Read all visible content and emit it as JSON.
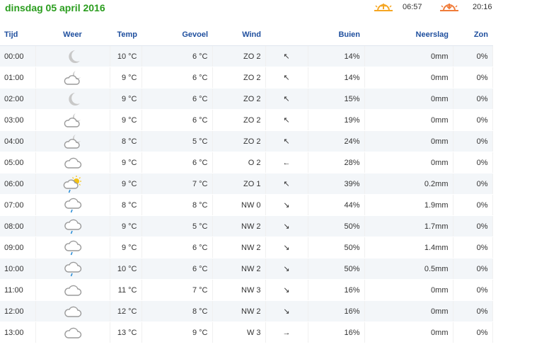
{
  "page": {
    "date_title": "dinsdag 05 april 2016",
    "sunrise": "06:57",
    "sunset": "20:16",
    "sunrise_icon": "sunrise-icon",
    "sunset_icon": "sunset-icon",
    "accent_color": "#2a9d1e",
    "header_color": "#1f4f9e"
  },
  "table": {
    "headers": {
      "time": "Tijd",
      "weather": "Weer",
      "temp": "Temp",
      "feels": "Gevoel",
      "wind": "Wind",
      "showers": "Buien",
      "precip": "Neerslag",
      "sun": "Zon"
    },
    "rows": [
      {
        "time": "00:00",
        "icon": "moon",
        "temp": "10 °C",
        "feels": "6 °C",
        "wind": "ZO 2",
        "arrow": "↖",
        "showers": "14%",
        "precip": "0mm",
        "sun": "0%"
      },
      {
        "time": "01:00",
        "icon": "cloud-moon",
        "temp": "9 °C",
        "feels": "6 °C",
        "wind": "ZO 2",
        "arrow": "↖",
        "showers": "14%",
        "precip": "0mm",
        "sun": "0%"
      },
      {
        "time": "02:00",
        "icon": "moon",
        "temp": "9 °C",
        "feels": "6 °C",
        "wind": "ZO 2",
        "arrow": "↖",
        "showers": "15%",
        "precip": "0mm",
        "sun": "0%"
      },
      {
        "time": "03:00",
        "icon": "cloud-moon",
        "temp": "9 °C",
        "feels": "6 °C",
        "wind": "ZO 2",
        "arrow": "↖",
        "showers": "19%",
        "precip": "0mm",
        "sun": "0%"
      },
      {
        "time": "04:00",
        "icon": "cloud-moon",
        "temp": "8 °C",
        "feels": "5 °C",
        "wind": "ZO 2",
        "arrow": "↖",
        "showers": "24%",
        "precip": "0mm",
        "sun": "0%"
      },
      {
        "time": "05:00",
        "icon": "cloud",
        "temp": "9 °C",
        "feels": "6 °C",
        "wind": "O 2",
        "arrow": "←",
        "showers": "28%",
        "precip": "0mm",
        "sun": "0%"
      },
      {
        "time": "06:00",
        "icon": "cloud-sun-rain",
        "temp": "9 °C",
        "feels": "7 °C",
        "wind": "ZO 1",
        "arrow": "↖",
        "showers": "39%",
        "precip": "0.2mm",
        "sun": "0%"
      },
      {
        "time": "07:00",
        "icon": "cloud-rain",
        "temp": "8 °C",
        "feels": "8 °C",
        "wind": "NW 0",
        "arrow": "↘",
        "showers": "44%",
        "precip": "1.9mm",
        "sun": "0%"
      },
      {
        "time": "08:00",
        "icon": "cloud-rain",
        "temp": "9 °C",
        "feels": "5 °C",
        "wind": "NW 2",
        "arrow": "↘",
        "showers": "50%",
        "precip": "1.7mm",
        "sun": "0%"
      },
      {
        "time": "09:00",
        "icon": "cloud-rain",
        "temp": "9 °C",
        "feels": "6 °C",
        "wind": "NW 2",
        "arrow": "↘",
        "showers": "50%",
        "precip": "1.4mm",
        "sun": "0%"
      },
      {
        "time": "10:00",
        "icon": "cloud-rain",
        "temp": "10 °C",
        "feels": "6 °C",
        "wind": "NW 2",
        "arrow": "↘",
        "showers": "50%",
        "precip": "0.5mm",
        "sun": "0%"
      },
      {
        "time": "11:00",
        "icon": "cloud",
        "temp": "11 °C",
        "feels": "7 °C",
        "wind": "NW 3",
        "arrow": "↘",
        "showers": "16%",
        "precip": "0mm",
        "sun": "0%"
      },
      {
        "time": "12:00",
        "icon": "cloud",
        "temp": "12 °C",
        "feels": "8 °C",
        "wind": "NW 2",
        "arrow": "↘",
        "showers": "16%",
        "precip": "0mm",
        "sun": "0%"
      },
      {
        "time": "13:00",
        "icon": "cloud",
        "temp": "13 °C",
        "feels": "9 °C",
        "wind": "W 3",
        "arrow": "→",
        "showers": "16%",
        "precip": "0mm",
        "sun": "0%"
      }
    ]
  }
}
